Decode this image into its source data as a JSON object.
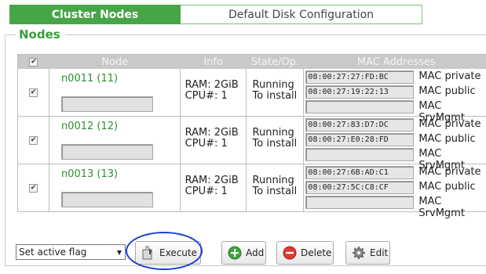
{
  "tabs": [
    {
      "label": "Cluster Nodes"
    },
    {
      "label": "Default Disk Configuration"
    }
  ],
  "section": {
    "legend": "Nodes"
  },
  "table": {
    "headers": {
      "node": "Node",
      "info": "Info",
      "state": "State/Op.",
      "mac": "MAC Addresses"
    },
    "check_mark": "✔",
    "rows": [
      {
        "node": "n0011 (11)",
        "ram": "RAM: 2GiB",
        "cpu": "CPU#: 1",
        "state": "Running",
        "op": "To install",
        "mac_private": "08:00:27:27:FD:BC",
        "mac_public": "08:00:27:19:22:13",
        "mac_srv": "",
        "label_private": "MAC private",
        "label_public": "MAC public",
        "label_srv": "MAC SrvMgmt"
      },
      {
        "node": "n0012 (12)",
        "ram": "RAM: 2GiB",
        "cpu": "CPU#: 1",
        "state": "Running",
        "op": "To install",
        "mac_private": "08:00:27:83:D7:DC",
        "mac_public": "08:00:27:E0:28:FD",
        "mac_srv": "",
        "label_private": "MAC private",
        "label_public": "MAC public",
        "label_srv": "MAC SrvMgmt"
      },
      {
        "node": "n0013 (13)",
        "ram": "RAM: 2GiB",
        "cpu": "CPU#: 1",
        "state": "Running",
        "op": "To install",
        "mac_private": "08:00:27:6B:AD:C1",
        "mac_public": "08:00:27:5C:C8:CF",
        "mac_srv": "",
        "label_private": "MAC private",
        "label_public": "MAC public",
        "label_srv": "MAC SrvMgmt"
      }
    ]
  },
  "controls": {
    "select_value": "Set active flag",
    "execute_label": "Execute",
    "add_label": "Add",
    "delete_label": "Delete",
    "edit_label": "Edit"
  },
  "colors": {
    "accent": "#46a546",
    "link": "#2f8f2f",
    "annotation": "#1b3fd6"
  },
  "icons": [
    "checkbox-icon",
    "execute-icon",
    "add-icon",
    "delete-icon",
    "edit-gear-icon",
    "dropdown-arrow-icon"
  ]
}
